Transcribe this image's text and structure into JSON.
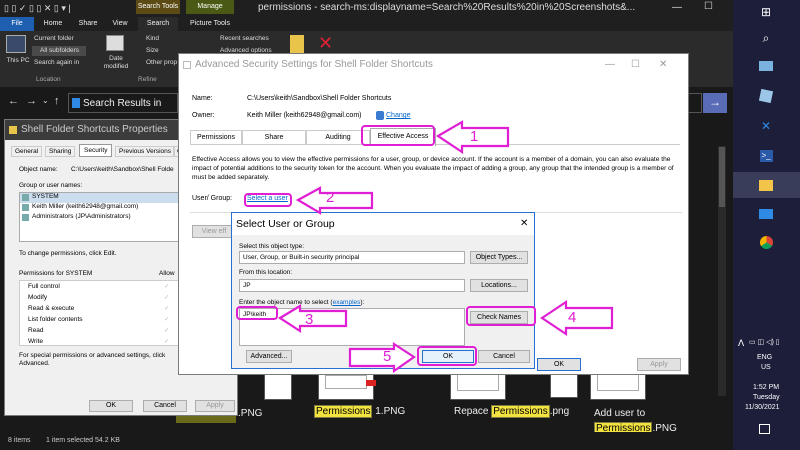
{
  "explorer": {
    "title": "permissions - search-ms:displayname=Search%20Results%20in%20Screenshots&...",
    "tabs": [
      "File",
      "Home",
      "Share",
      "View",
      "Search",
      "Picture Tools"
    ],
    "search_tools_label": "Search Tools",
    "manage_label": "Manage",
    "ribbon": {
      "this_pc": "This PC",
      "current_folder": "Current folder",
      "all_subfolders": "All subfolders",
      "search_again_in": "Search again in",
      "location": "Location",
      "date_modified": "Date modified",
      "kind": "Kind",
      "size": "Size",
      "other_props": "Other prop",
      "refine": "Refine",
      "recent_searches": "Recent searches",
      "advanced_options": "Advanced options"
    },
    "address": "Search Results in",
    "status": {
      "items": "8 items",
      "selected": "1 item selected  54.2 KB"
    },
    "files": [
      {
        "pre": "",
        "hl": "Permissions",
        "post": " 1.PNG"
      },
      {
        "pre": "Repace ",
        "hl": "Permissions",
        "post": ".png"
      },
      {
        "pre": "Add user to ",
        "hl": "Permissions",
        "post": ".PNG"
      }
    ],
    "partial_file": ".PNG"
  },
  "properties": {
    "title": "Shell Folder Shortcuts Properties",
    "tabs": [
      "General",
      "Sharing",
      "Security",
      "Previous Versions",
      "C"
    ],
    "object_name_label": "Object name:",
    "object_name": "C:\\Users\\keith\\Sandbox\\Shell Folde",
    "group_label": "Group or user names:",
    "users": [
      "SYSTEM",
      "Keith Miller (keith62948@gmail.com)",
      "Administrators (JP\\Administrators)"
    ],
    "change_note": "To change permissions, click Edit.",
    "perms_for": "Permissions for SYSTEM",
    "allow": "Allow",
    "perms": [
      "Full control",
      "Modify",
      "Read & execute",
      "List folder contents",
      "Read",
      "Write"
    ],
    "special_note": "For special permissions or advanced settings, click Advanced.",
    "ok": "OK",
    "cancel": "Cancel",
    "apply": "Apply"
  },
  "advanced": {
    "title": "Advanced Security Settings for Shell Folder Shortcuts",
    "name_label": "Name:",
    "name": "C:\\Users\\keith\\Sandbox\\Shell Folder Shortcuts",
    "owner_label": "Owner:",
    "owner": "Keith Miller (keith62948@gmail.com)",
    "change": "Change",
    "tabs": [
      "Permissions",
      "Share",
      "Auditing",
      "Effective Access"
    ],
    "description": "Effective Access allows you to view the effective permissions for a user, group, or device account. If the account is a member of a domain, you can also evaluate the impact of potential additions to the security token for the account. When you evaluate the impact of adding a group, any group that the intended group is a member of must be added separately.",
    "user_group_label": "User/ Group:",
    "select_user": "Select a user",
    "view_btn": "View eff",
    "ok": "OK",
    "apply": "Apply"
  },
  "select_dialog": {
    "title": "Select User or Group",
    "object_type_label": "Select this object type:",
    "object_type": "User, Group, or Built-in security principal",
    "object_types_btn": "Object Types...",
    "location_label": "From this location:",
    "location": "JP",
    "locations_btn": "Locations...",
    "enter_label_a": "Enter the object name to select (",
    "examples": "examples",
    "enter_label_b": "):",
    "object_name": "JP\\keith",
    "check_names": "Check Names",
    "advanced": "Advanced...",
    "ok": "OK",
    "cancel": "Cancel"
  },
  "callouts": [
    "1",
    "2",
    "3",
    "4",
    "5"
  ],
  "tray": {
    "lang1": "ENG",
    "lang2": "US",
    "time": "1:52 PM",
    "day": "Tuesday",
    "date": "11/30/2021"
  },
  "colors": {
    "annotation": "#e01fd4",
    "taskbar": "#1c1e3a",
    "highlight": "#f2e340"
  }
}
